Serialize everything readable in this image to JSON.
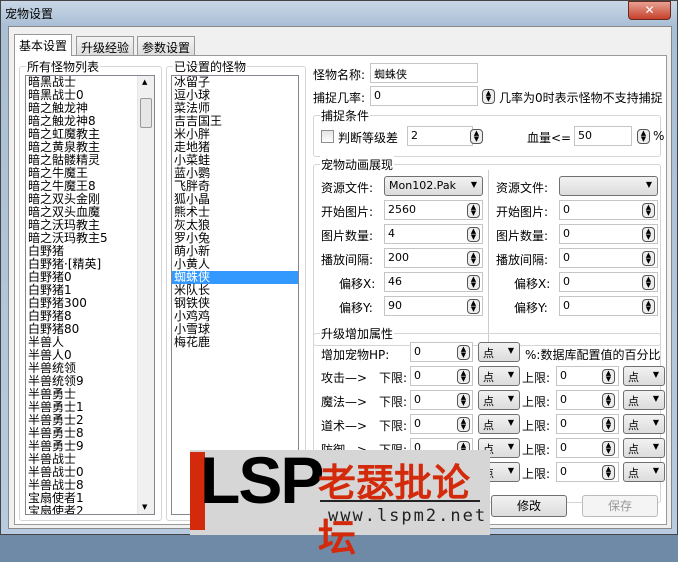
{
  "window": {
    "title": "宠物设置",
    "close_icon": "close-icon"
  },
  "tabs": [
    "基本设置",
    "升级经验",
    "参数设置"
  ],
  "all_monsters": {
    "label": "所有怪物列表",
    "items": [
      "暗黑战士",
      "暗黑战士0",
      "暗之触龙神",
      "暗之触龙神8",
      "暗之虹魔教主",
      "暗之黄泉教主",
      "暗之骷髅精灵",
      "暗之牛魔王",
      "暗之牛魔王8",
      "暗之双头金刚",
      "暗之双头血魔",
      "暗之沃玛教主",
      "暗之沃玛教主5",
      "白野猪",
      "白野猪·[精英]",
      "白野猪0",
      "白野猪1",
      "白野猪300",
      "白野猪8",
      "白野猪80",
      "半兽人",
      "半兽人0",
      "半兽统领",
      "半兽统领9",
      "半兽勇士",
      "半兽勇士1",
      "半兽勇士2",
      "半兽勇士8",
      "半兽勇士9",
      "半兽战士",
      "半兽战士0",
      "半兽战士8",
      "宝扇使者1",
      "宝扇使者2"
    ]
  },
  "set_monsters": {
    "label": "已设置的怪物",
    "items": [
      "冰留子",
      "逗小球",
      "菜法师",
      "吉吉国王",
      "米小胖",
      "走地猪",
      "小菜蛙",
      "蓝小鹦",
      "飞胖奇",
      "狐小晶",
      "熊术士",
      "灰太狼",
      "罗小兔",
      "萌小新",
      "小黄人",
      "蜘蛛侠",
      "米队长",
      "钢铁侠",
      "小鸡鸡",
      "小雪球",
      "梅花鹿"
    ],
    "selected": "蜘蛛侠"
  },
  "form": {
    "name_label": "怪物名称:",
    "name_value": "蜘蛛侠",
    "rate_label": "捕捉几率:",
    "rate_value": "0",
    "rate_hint": "几率为0时表示怪物不支持捕捉",
    "cond": {
      "label": "捕捉条件",
      "check_label": "判断等级差",
      "checked": false,
      "level_value": "2",
      "hp_label": "血量<=",
      "hp_value": "50",
      "pct": "%"
    },
    "anim": {
      "label": "宠物动画展现",
      "rows": [
        {
          "label": "资源文件:",
          "left": "Mon102.Pak",
          "right": ""
        },
        {
          "label": "开始图片:",
          "left": "2560",
          "right": "0"
        },
        {
          "label": "图片数量:",
          "left": "4",
          "right": "0"
        },
        {
          "label": "播放间隔:",
          "left": "200",
          "right": "0"
        },
        {
          "label": "偏移X:",
          "left": "46",
          "right": "0"
        },
        {
          "label": "偏移Y:",
          "left": "90",
          "right": "0"
        }
      ]
    },
    "upgrade": {
      "label": "升级增加属性",
      "hp_label": "增加宠物HP:",
      "hp_value": "0",
      "hp_unit": "点",
      "hp_hint": "%:数据库配置值的百分比",
      "lower": "下限:",
      "upper": "上限:",
      "rows": [
        {
          "label": "攻击—>",
          "low": "0",
          "low_unit": "点",
          "high": "0",
          "high_unit": "点"
        },
        {
          "label": "魔法—>",
          "low": "0",
          "low_unit": "点",
          "high": "0",
          "high_unit": "点"
        },
        {
          "label": "道术—>",
          "low": "0",
          "low_unit": "点",
          "high": "0",
          "high_unit": "点"
        },
        {
          "label": "防御—>",
          "low": "0",
          "low_unit": "点",
          "high": "0",
          "high_unit": "点"
        },
        {
          "label": "",
          "low": "0",
          "low_unit": "点",
          "high": "0",
          "high_unit": "点"
        }
      ]
    },
    "modify_button": "修改",
    "save_button": "保存"
  },
  "watermark": {
    "logo": "LSP",
    "name": "老瑟批论坛",
    "url": "www.lspm2.net"
  }
}
